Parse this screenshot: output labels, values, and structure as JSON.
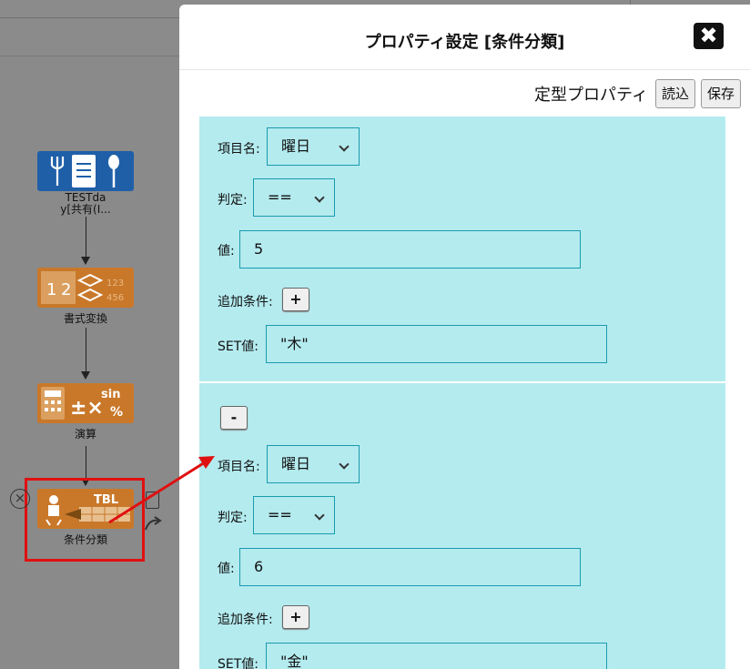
{
  "canvas": {
    "nodes": [
      {
        "label_line1": "TESTda",
        "label_line2": "y[共有(I..."
      },
      {
        "label": "書式変換"
      },
      {
        "label": "演算"
      },
      {
        "label": "条件分類"
      }
    ],
    "close_glyph": "×"
  },
  "modal": {
    "title": "プロパティ設定 [条件分類]",
    "close_glyph": "✖",
    "preset_label": "定型プロパティ",
    "load_button": "読込",
    "save_button": "保存"
  },
  "conditions": [
    {
      "item_label": "項目名:",
      "item_value": "曜日",
      "judge_label": "判定:",
      "judge_value": "==",
      "value_label": "値:",
      "value": "5",
      "add_label": "追加条件:",
      "add_button": "+",
      "set_label": "SET値:",
      "set_value": "\"木\""
    },
    {
      "remove_button": "-",
      "item_label": "項目名:",
      "item_value": "曜日",
      "judge_label": "判定:",
      "judge_value": "==",
      "value_label": "値:",
      "value": "6",
      "add_label": "追加条件:",
      "add_button": "+",
      "set_label": "SET値:",
      "set_value": "\"金\""
    }
  ],
  "colors": {
    "panel_bg": "#b4ebef",
    "field_border": "#1a9aae",
    "node_blue": "#1f5fa8",
    "node_orange": "#c9782a",
    "highlight_red": "#e01010"
  }
}
